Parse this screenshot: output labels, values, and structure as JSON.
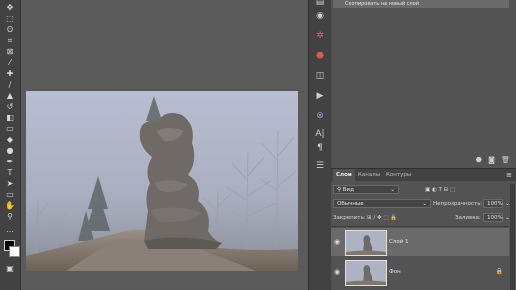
{
  "history": {
    "item_label": "Скопировать на новый слой"
  },
  "layers_panel": {
    "tabs": [
      "Слои",
      "Каналы",
      "Контуры"
    ],
    "filter_label": "Вид",
    "blend_mode": "Обычные",
    "opacity_label": "Непрозрачность:",
    "opacity_value": "100%",
    "lock_label": "Закрепить:",
    "fill_label": "Заливка:",
    "fill_value": "100%",
    "layers": [
      {
        "name": "Слой 1",
        "selected": true,
        "locked": false
      },
      {
        "name": "Фон",
        "selected": false,
        "locked": true
      }
    ]
  },
  "colors": {
    "accent": "#6a6a6a",
    "panel": "#535353",
    "toolbar": "#424242"
  },
  "tool_icons": [
    "move-icon",
    "marquee-icon",
    "lasso-icon",
    "crop-icon",
    "frame-icon",
    "eyedropper-icon",
    "healing-icon",
    "brush-icon",
    "stamp-icon",
    "history-brush-icon",
    "eraser-icon",
    "gradient-icon",
    "blur-icon",
    "dodge-icon",
    "pen-icon",
    "type-icon",
    "path-select-icon",
    "rectangle-icon",
    "hand-icon",
    "zoom-icon",
    "more-tools-icon",
    "color-swatches-icon",
    "quick-mask-icon",
    "screen-mode-icon"
  ]
}
